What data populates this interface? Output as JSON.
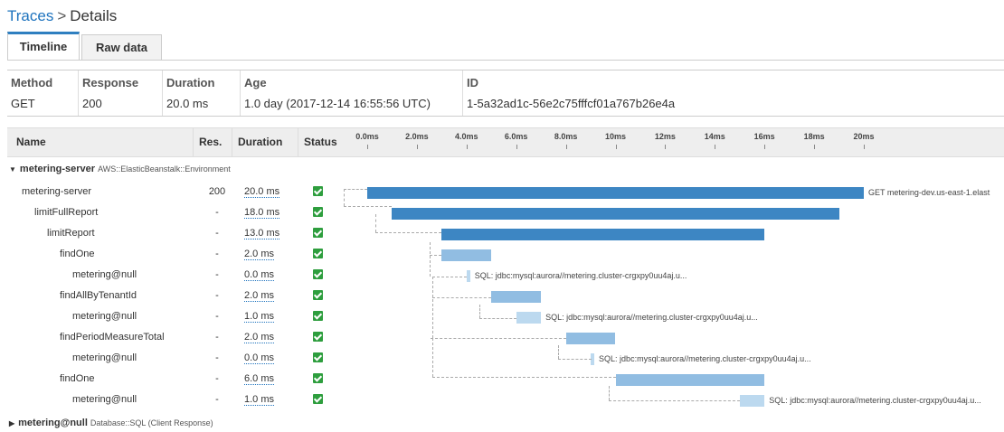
{
  "breadcrumb": {
    "root": "Traces",
    "separator": ">",
    "current": "Details"
  },
  "tabs": [
    {
      "label": "Timeline",
      "active": true
    },
    {
      "label": "Raw data",
      "active": false
    }
  ],
  "summary": {
    "method": {
      "header": "Method",
      "value": "GET"
    },
    "response": {
      "header": "Response",
      "value": "200"
    },
    "duration": {
      "header": "Duration",
      "value": "20.0 ms"
    },
    "age": {
      "header": "Age",
      "value": "1.0 day (2017-12-14 16:55:56 UTC)"
    },
    "id": {
      "header": "ID",
      "value": "1-5a32ad1c-56e2c75fffcf01a767b26e4a"
    }
  },
  "columns": {
    "name": "Name",
    "res": "Res.",
    "duration": "Duration",
    "status": "Status"
  },
  "ticks": [
    "0.0ms",
    "2.0ms",
    "4.0ms",
    "6.0ms",
    "8.0ms",
    "10ms",
    "12ms",
    "14ms",
    "16ms",
    "18ms",
    "20ms"
  ],
  "sections": [
    {
      "name": "metering-server",
      "type": "AWS::ElasticBeanstalk::Environment",
      "expanded": true
    },
    {
      "name": "metering@null",
      "type": "Database::SQL (Client Response)",
      "expanded": false
    }
  ],
  "rows": [
    {
      "name": "metering-server",
      "indent": 0,
      "res": "200",
      "duration": "20.0 ms",
      "status": "ok",
      "start_ms": 0.0,
      "dur_ms": 20.0,
      "shade": "dark",
      "label": "GET metering-dev.us-east-1.elast"
    },
    {
      "name": "limitFullReport",
      "indent": 1,
      "res": "-",
      "duration": "18.0 ms",
      "status": "ok",
      "start_ms": 1.0,
      "dur_ms": 18.0,
      "shade": "dark",
      "label": ""
    },
    {
      "name": "limitReport",
      "indent": 2,
      "res": "-",
      "duration": "13.0 ms",
      "status": "ok",
      "start_ms": 3.0,
      "dur_ms": 13.0,
      "shade": "dark",
      "label": ""
    },
    {
      "name": "findOne",
      "indent": 3,
      "res": "-",
      "duration": "2.0 ms",
      "status": "ok",
      "start_ms": 3.0,
      "dur_ms": 2.0,
      "shade": "mid",
      "label": ""
    },
    {
      "name": "metering@null",
      "indent": 4,
      "res": "-",
      "duration": "0.0 ms",
      "status": "ok",
      "start_ms": 4.0,
      "dur_ms": 0.0,
      "shade": "light",
      "label": "SQL: jdbc:mysql:aurora//metering.cluster-crgxpy0uu4aj.u..."
    },
    {
      "name": "findAllByTenantId",
      "indent": 3,
      "res": "-",
      "duration": "2.0 ms",
      "status": "ok",
      "start_ms": 5.0,
      "dur_ms": 2.0,
      "shade": "mid",
      "label": ""
    },
    {
      "name": "metering@null",
      "indent": 4,
      "res": "-",
      "duration": "1.0 ms",
      "status": "ok",
      "start_ms": 6.0,
      "dur_ms": 1.0,
      "shade": "light",
      "label": "SQL: jdbc:mysql:aurora//metering.cluster-crgxpy0uu4aj.u..."
    },
    {
      "name": "findPeriodMeasureTotal",
      "indent": 3,
      "res": "-",
      "duration": "2.0 ms",
      "status": "ok",
      "start_ms": 8.0,
      "dur_ms": 2.0,
      "shade": "mid",
      "label": ""
    },
    {
      "name": "metering@null",
      "indent": 4,
      "res": "-",
      "duration": "0.0 ms",
      "status": "ok",
      "start_ms": 9.0,
      "dur_ms": 0.0,
      "shade": "light",
      "label": "SQL: jdbc:mysql:aurora//metering.cluster-crgxpy0uu4aj.u..."
    },
    {
      "name": "findOne",
      "indent": 3,
      "res": "-",
      "duration": "6.0 ms",
      "status": "ok",
      "start_ms": 10.0,
      "dur_ms": 6.0,
      "shade": "mid",
      "label": ""
    },
    {
      "name": "metering@null",
      "indent": 4,
      "res": "-",
      "duration": "1.0 ms",
      "status": "ok",
      "start_ms": 15.0,
      "dur_ms": 1.0,
      "shade": "light",
      "label": "SQL: jdbc:mysql:aurora//metering.cluster-crgxpy0uu4aj.u..."
    }
  ],
  "colors": {
    "link": "#1e73be",
    "tab_accent": "#2f7fc0",
    "bar_dark": "#3d86c3",
    "bar_mid": "#91bde2",
    "bar_light": "#bcd9ef",
    "status_ok": "#2e9e3e"
  }
}
